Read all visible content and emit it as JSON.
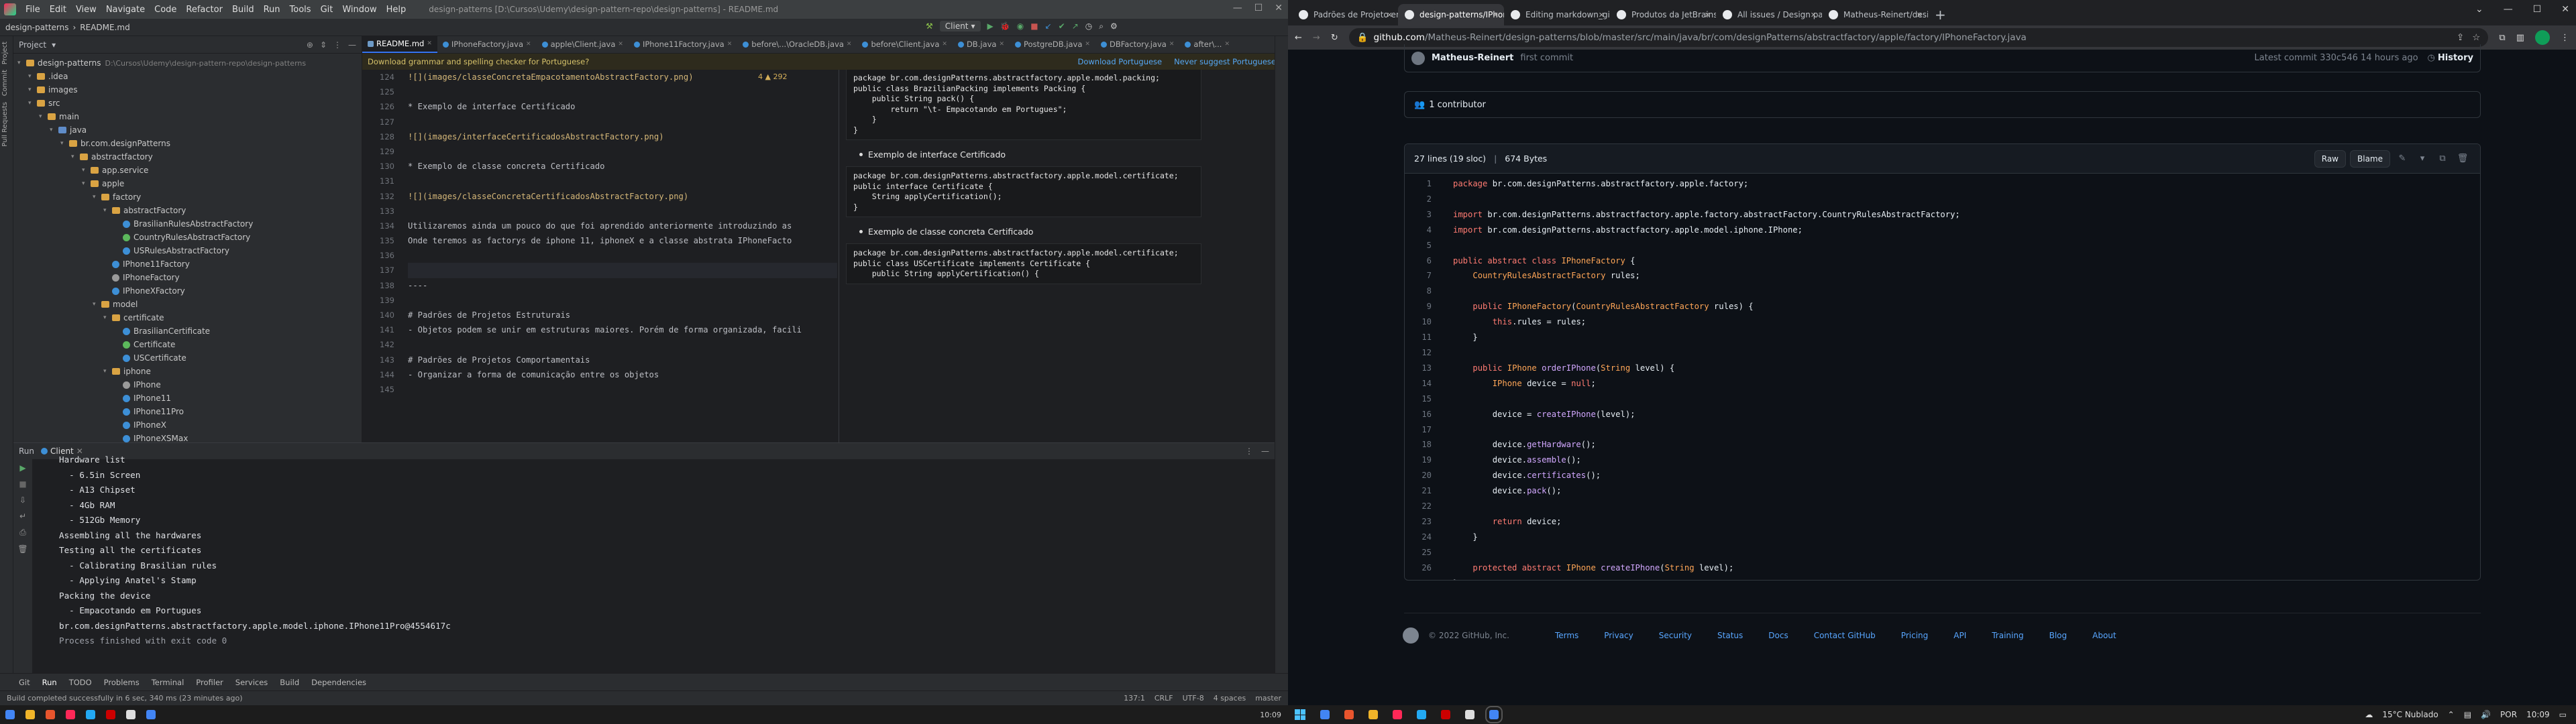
{
  "ide": {
    "title": "design-patterns [D:\\Cursos\\Udemy\\design-pattern-repo\\design-patterns] - README.md",
    "menu": [
      "File",
      "Edit",
      "View",
      "Navigate",
      "Code",
      "Refactor",
      "Build",
      "Run",
      "Tools",
      "Git",
      "Window",
      "Help"
    ],
    "breadcrumb": [
      "design-patterns",
      "README.md"
    ],
    "run_config": "Client",
    "project_label": "Project",
    "tree": [
      {
        "label": "design-patterns",
        "extra": "D:\\Cursos\\Udemy\\design-pattern-repo\\design-patterns",
        "icon": "folder",
        "indent": 0
      },
      {
        "label": ".idea",
        "icon": "folder",
        "indent": 1
      },
      {
        "label": "images",
        "icon": "folder",
        "indent": 1
      },
      {
        "label": "src",
        "icon": "folder",
        "indent": 1
      },
      {
        "label": "main",
        "icon": "folder",
        "indent": 2
      },
      {
        "label": "java",
        "icon": "folder-blue",
        "indent": 3
      },
      {
        "label": "br.com.designPatterns",
        "icon": "folder",
        "indent": 4
      },
      {
        "label": "abstractfactory",
        "icon": "folder",
        "indent": 5
      },
      {
        "label": "app.service",
        "icon": "folder",
        "indent": 6
      },
      {
        "label": "apple",
        "icon": "folder",
        "indent": 6
      },
      {
        "label": "factory",
        "icon": "folder",
        "indent": 7
      },
      {
        "label": "abstractFactory",
        "icon": "folder",
        "indent": 8
      },
      {
        "label": "BrasilianRulesAbstractFactory",
        "icon": "cls",
        "indent": 9
      },
      {
        "label": "CountryRulesAbstractFactory",
        "icon": "ifc",
        "indent": 9
      },
      {
        "label": "USRulesAbstractFactory",
        "icon": "cls",
        "indent": 9
      },
      {
        "label": "IPhone11Factory",
        "icon": "cls",
        "indent": 8
      },
      {
        "label": "IPhoneFactory",
        "icon": "abs-cls",
        "indent": 8
      },
      {
        "label": "IPhoneXFactory",
        "icon": "cls",
        "indent": 8
      },
      {
        "label": "model",
        "icon": "folder",
        "indent": 7
      },
      {
        "label": "certificate",
        "icon": "folder",
        "indent": 8
      },
      {
        "label": "BrasilianCertificate",
        "icon": "cls",
        "indent": 9
      },
      {
        "label": "Certificate",
        "icon": "ifc",
        "indent": 9
      },
      {
        "label": "USCertificate",
        "icon": "cls",
        "indent": 9
      },
      {
        "label": "iphone",
        "icon": "folder",
        "indent": 8
      },
      {
        "label": "IPhone",
        "icon": "abs-cls",
        "indent": 9
      },
      {
        "label": "IPhone11",
        "icon": "cls",
        "indent": 9
      },
      {
        "label": "IPhone11Pro",
        "icon": "cls",
        "indent": 9
      },
      {
        "label": "IPhoneX",
        "icon": "cls",
        "indent": 9
      },
      {
        "label": "IPhoneXSMax",
        "icon": "cls",
        "indent": 9
      }
    ],
    "tabs": [
      "README.md",
      "IPhoneFactory.java",
      "apple\\Client.java",
      "IPhone11Factory.java",
      "before\\...\\OracleDB.java",
      "before\\Client.java",
      "DB.java",
      "PostgreDB.java",
      "DBFactory.java",
      "after\\..."
    ],
    "grammar": {
      "text": "Download grammar and spelling checker for Portuguese?",
      "download": "Download Portuguese",
      "never": "Never suggest Portuguese"
    },
    "warnings": "4 ▲ 292",
    "gutter_lines": [
      "124",
      "125",
      "126",
      "127",
      "128",
      "129",
      "130",
      "131",
      "132",
      "133",
      "134",
      "135",
      "136",
      "137",
      "138",
      "139",
      "140",
      "141",
      "142",
      "143",
      "144",
      "145"
    ],
    "code_lines": [
      "![](images/classeConcretaEmpacotamentoAbstractFactory.png)",
      "",
      "* Exemplo de interface Certificado",
      "",
      "![](images/interfaceCertificadosAbstractFactory.png)",
      "",
      "* Exemplo de classe concreta Certificado",
      "",
      "![](images/classeConcretaCertificadosAbstractFactory.png)",
      "",
      "Utilizaremos ainda um pouco do que foi aprendido anteriormente introduzindo as",
      "Onde teremos as factorys de iphone 11, iphoneX e a classe abstrata IPhoneFacto",
      "",
      "",
      "----",
      "",
      "# Padrões de Projetos Estruturais",
      "- Objetos podem se unir em estruturas maiores. Porém de forma organizada, facili",
      "",
      "# Padrões de Projetos Comportamentais",
      "- Organizar a forma de comunicação entre os objetos",
      ""
    ],
    "preview": {
      "code1": [
        "package br.com.designPatterns.abstractfactory.apple.model.packing;",
        "",
        "public class BrazilianPacking implements Packing {",
        "",
        "    public String pack() {",
        "        return \"\\t- Empacotando em Portugues\";",
        "    }",
        "",
        "}"
      ],
      "bullet1": "Exemplo de interface Certificado",
      "code2": [
        "package br.com.designPatterns.abstractfactory.apple.model.certificate;",
        "",
        "public interface Certificate {",
        "    String applyCertification();",
        "}"
      ],
      "bullet2": "Exemplo de classe concreta Certificado",
      "code3": [
        "package br.com.designPatterns.abstractfactory.apple.model.certificate;",
        "",
        "public class USCertificate implements Certificate {",
        "",
        "    public String applyCertification() {"
      ]
    },
    "run": {
      "label": "Run",
      "config": "Client",
      "output": [
        "Hardware list",
        "  - 6.5in Screen",
        "  - A13 Chipset",
        "  - 4Gb RAM",
        "  - 512Gb Memory",
        "Assembling all the hardwares",
        "Testing all the certificates",
        "  - Calibrating Brasilian rules",
        "  - Applying Anatel's Stamp",
        "Packing the device",
        "  - Empacotando em Portugues",
        "br.com.designPatterns.abstractfactory.apple.model.iphone.IPhone11Pro@4554617c",
        "",
        "Process finished with exit code 0"
      ]
    },
    "bottom_tools": [
      "Git",
      "Run",
      "TODO",
      "Problems",
      "Terminal",
      "Profiler",
      "Services",
      "Build",
      "Dependencies"
    ],
    "status": {
      "left": "Build completed successfully in 6 sec, 340 ms (23 minutes ago)",
      "pos": "137:1",
      "eol": "CRLF",
      "enc": "UTF-8",
      "indent": "4 spaces",
      "branch": "master"
    }
  },
  "browser": {
    "tabs": [
      {
        "title": "Padrões de Projeto em JAVA",
        "active": false
      },
      {
        "title": "design-patterns/IPhoneFactory",
        "active": true
      },
      {
        "title": "Editing markdown_git/README",
        "active": false
      },
      {
        "title": "Produtos da JetBrains para",
        "active": false
      },
      {
        "title": "All issues / Design patterns",
        "active": false
      },
      {
        "title": "Matheus-Reinert/design-pat",
        "active": false
      }
    ],
    "url_host": "github.com",
    "url_path": "/Matheus-Reinert/design-patterns/blob/master/src/main/java/br/com/designPatterns/abstractfactory/apple/factory/IPhoneFactory.java",
    "commit": {
      "author": "Matheus-Reinert",
      "message": "first commit",
      "latest": "Latest commit 330c546 14 hours ago",
      "history": "History"
    },
    "contributors": "1 contributor",
    "file_meta": {
      "lines": "27 lines (19 sloc)",
      "size": "674 Bytes",
      "raw": "Raw",
      "blame": "Blame"
    },
    "code": [
      "package br.com.designPatterns.abstractfactory.apple.factory;",
      "",
      "import br.com.designPatterns.abstractfactory.apple.factory.abstractFactory.CountryRulesAbstractFactory;",
      "import br.com.designPatterns.abstractfactory.apple.model.iphone.IPhone;",
      "",
      "public abstract class IPhoneFactory {",
      "    CountryRulesAbstractFactory rules;",
      "",
      "    public IPhoneFactory(CountryRulesAbstractFactory rules) {",
      "        this.rules = rules;",
      "    }",
      "",
      "    public IPhone orderIPhone(String level) {",
      "        IPhone device = null;",
      "",
      "        device = createIPhone(level);",
      "",
      "        device.getHardware();",
      "        device.assemble();",
      "        device.certificates();",
      "        device.pack();",
      "",
      "        return device;",
      "    }",
      "",
      "    protected abstract IPhone createIPhone(String level);",
      "}"
    ],
    "footer": {
      "copyright": "© 2022 GitHub, Inc.",
      "links": [
        "Terms",
        "Privacy",
        "Security",
        "Status",
        "Docs",
        "Contact GitHub",
        "Pricing",
        "API",
        "Training",
        "Blog",
        "About"
      ]
    }
  },
  "taskbar": {
    "weather": "15°C Nublado",
    "lang": "POR",
    "time": "10:09"
  }
}
